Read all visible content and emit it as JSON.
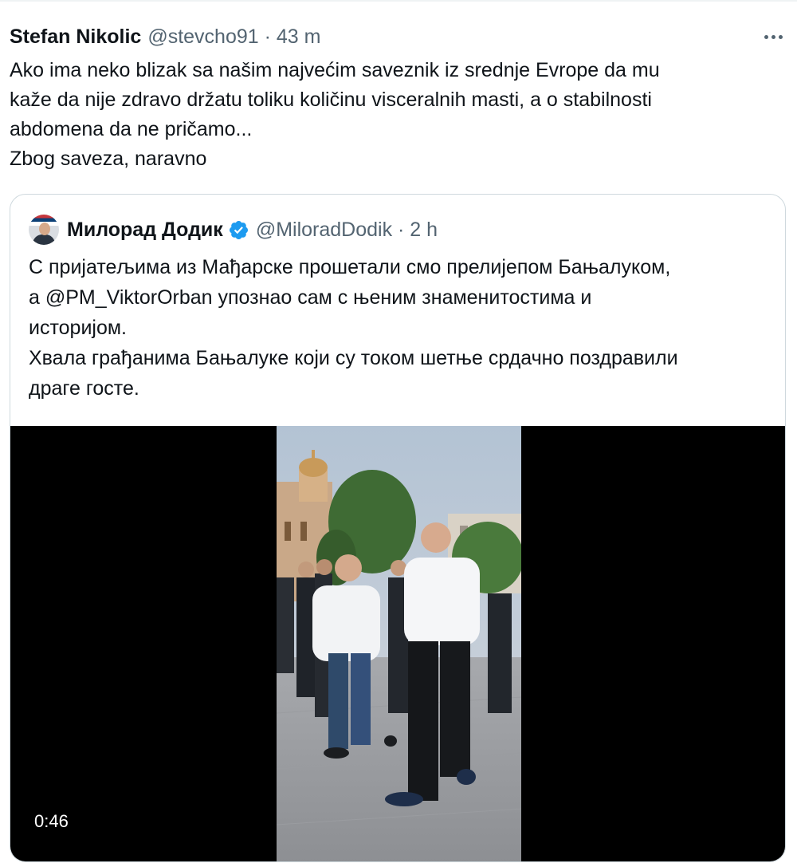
{
  "tweet": {
    "author_name": "Stefan Nikolic",
    "meta": "@stevcho91 · 43 m",
    "more_icon": "more-horizontal-icon",
    "lines": [
      "Ako ima neko blizak sa našim najvećim saveznik iz srednje Evrope da mu",
      "kaže da nije zdravo držatu toliku količinu visceralnih masti, a o stabilnosti",
      "abdomena da ne pričamo...",
      "Zbog saveza, naravno"
    ]
  },
  "quote": {
    "author_name": "Милорад Додик",
    "verified_icon": "verified-badge-icon",
    "verified_color": "#1d9bf0",
    "meta": "@MiloradDodik · 2 h",
    "lines": [
      "С пријатељима из Мађарске прошетали смо прелијепом Бањалуком,",
      "а @PM_ViktorOrban  упознао сам с њеним знаменитостима и",
      "историјом.",
      "Хвала грађанима Бањалуке који су током шетње срдачно поздравили",
      "драге госте."
    ],
    "video": {
      "duration": "0:46"
    }
  },
  "colors": {
    "text": "#0f1419",
    "secondary": "#536471",
    "border": "#cfd9de",
    "video_bg": "#000000"
  }
}
